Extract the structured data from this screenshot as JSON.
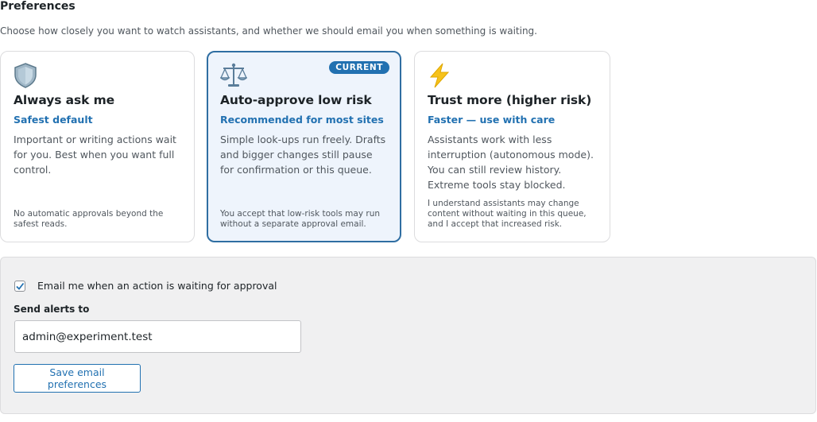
{
  "header": {
    "title": "Preferences",
    "subtitle": "Choose how closely you want to watch assistants, and whether we should email you when something is waiting."
  },
  "modes": [
    {
      "icon": "shield-icon",
      "title": "Always ask me",
      "tag": "Safest default",
      "description": "Important or writing actions wait for you. Best when you want full control.",
      "note": "No automatic approvals beyond the safest reads.",
      "current": false
    },
    {
      "icon": "scales-icon",
      "title": "Auto-approve low risk",
      "tag": "Recommended for most sites",
      "description": "Simple look-ups run freely. Drafts and bigger changes still pause for confirmation or this queue.",
      "note": "You accept that low-risk tools may run without a separate approval email.",
      "current": true,
      "badge": "CURRENT"
    },
    {
      "icon": "lightning-icon",
      "title": "Trust more (higher risk)",
      "tag": "Faster — use with care",
      "description": "Assistants work with less interruption (autonomous mode). You can still review history. Extreme tools stay blocked.",
      "note": "I understand assistants may change content without waiting in this queue, and I accept that increased risk.",
      "current": false
    }
  ],
  "email": {
    "checkbox_label": "Email me when an action is waiting for approval",
    "checked": true,
    "send_label": "Send alerts to",
    "address": "admin@experiment.test",
    "save_label": "Save email preferences"
  },
  "colors": {
    "accent": "#2271b1",
    "current_bg": "#eef4fc",
    "current_border": "#2f6ea2",
    "panel_bg": "#f0f0f1"
  }
}
